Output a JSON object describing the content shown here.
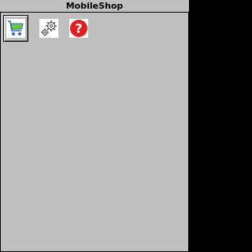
{
  "window": {
    "title": "MobileShop"
  },
  "toolbar": {
    "items": [
      {
        "icon": "shopping-cart-icon",
        "selected": true
      },
      {
        "icon": "settings-gears-icon",
        "selected": false
      },
      {
        "icon": "help-icon",
        "selected": false,
        "glyph": "?"
      }
    ]
  },
  "colors": {
    "background": "#c0c0c0",
    "help_red": "#e02020",
    "cart_green": "#66cc33",
    "cart_blue": "#3366cc"
  }
}
